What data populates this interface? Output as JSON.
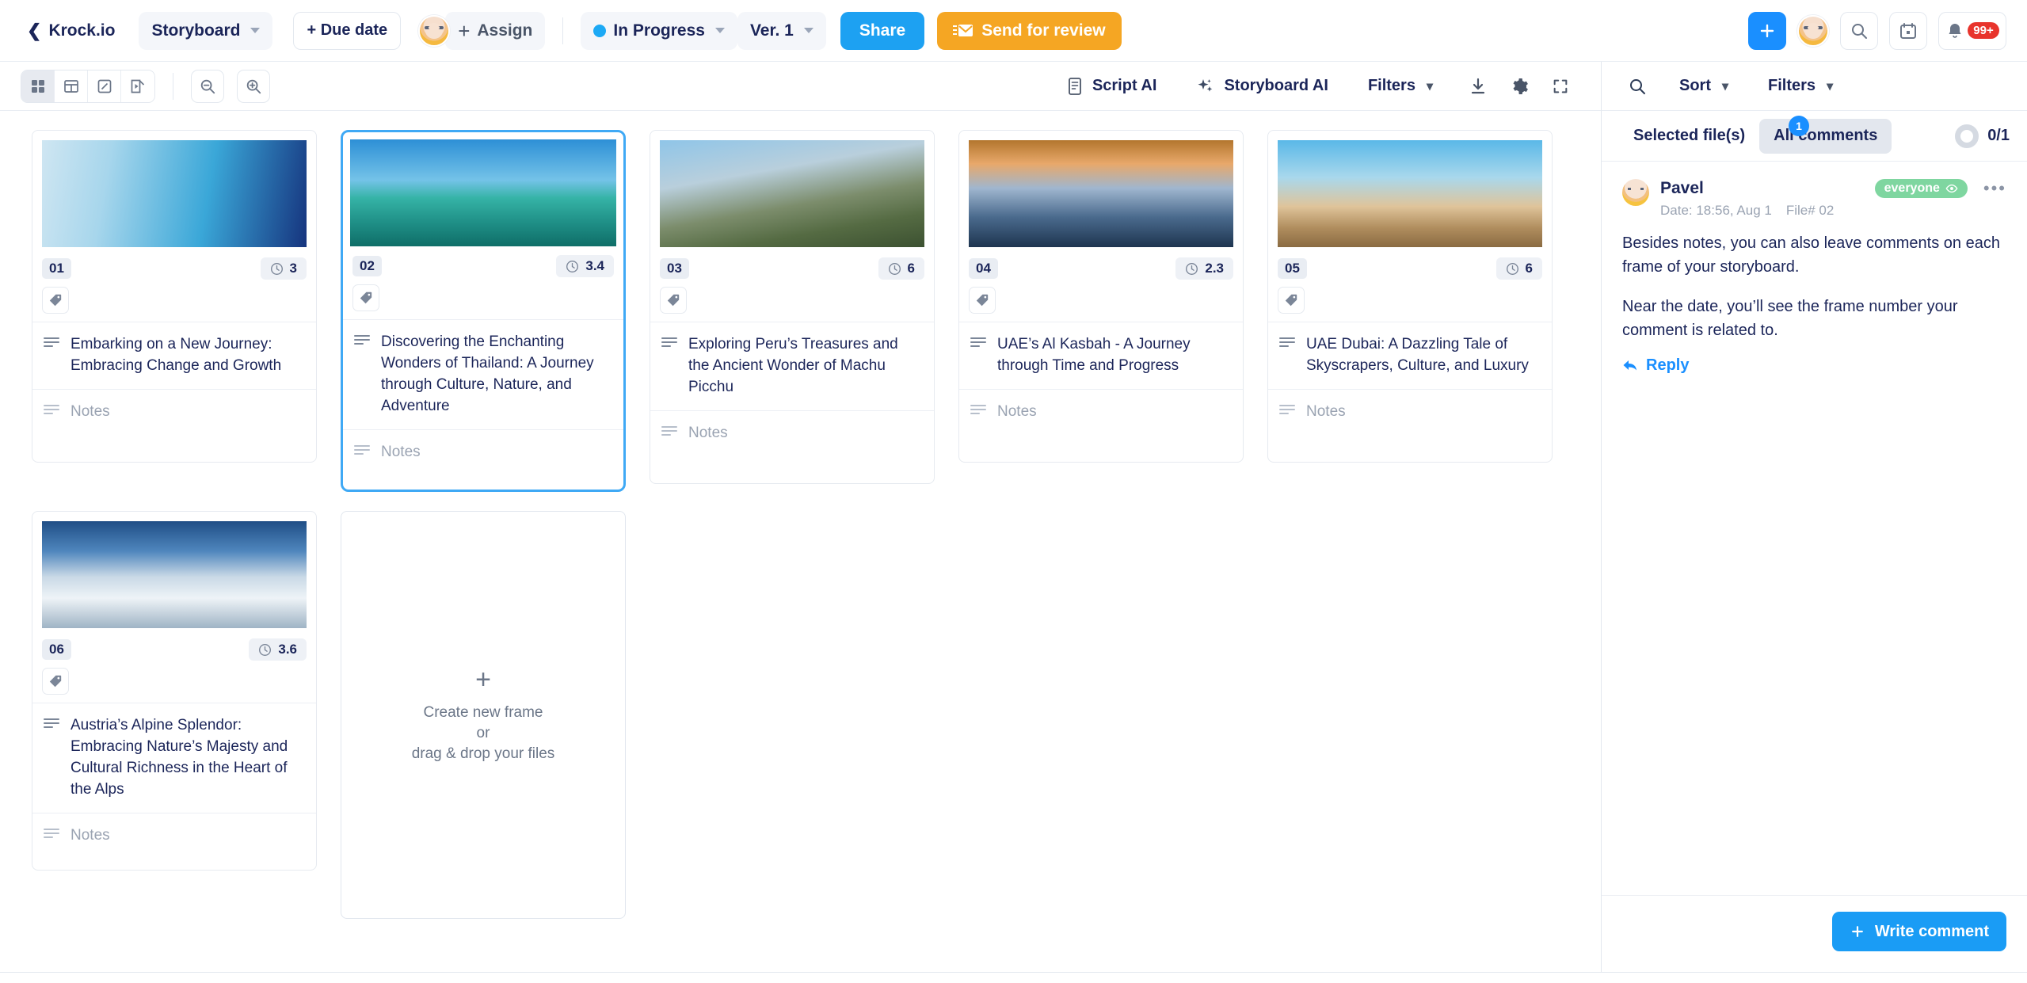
{
  "topbar": {
    "back_label": "Krock.io",
    "project_label": "Storyboard",
    "due_date_label": "+ Due date",
    "assign_label": "Assign",
    "status_label": "In Progress",
    "status_color": "#1ca9f5",
    "version_label": "Ver. 1",
    "share_label": "Share",
    "send_review_label": "Send for review",
    "notifications_badge": "99+",
    "icons": {
      "add": "plus-icon",
      "user": "avatar-icon",
      "search": "search-icon",
      "calendar": "calendar-icon",
      "bell": "bell-icon"
    }
  },
  "toolbar": {
    "view_modes": [
      "grid-view-icon",
      "table-view-icon",
      "edit-view-icon",
      "present-view-icon"
    ],
    "zoom_out": "zoom-out-icon",
    "zoom_in": "zoom-in-icon",
    "script_ai_label": "Script AI",
    "storyboard_ai_label": "Storyboard AI",
    "filters_label": "Filters",
    "download_icon": "download-icon",
    "settings_icon": "gear-icon",
    "fullscreen_icon": "fullscreen-icon"
  },
  "right_toolbar": {
    "search_icon": "search-icon",
    "sort_label": "Sort",
    "filters_label": "Filters"
  },
  "comments_panel": {
    "tab_selected_files": "Selected file(s)",
    "tab_all_comments": "All comments",
    "tab_badge": "1",
    "progress_label": "0/1",
    "comment": {
      "author": "Pavel",
      "date": "Date: 18:56, Aug 1",
      "file": "File# 02",
      "visibility": "everyone",
      "paragraph_1": "Besides notes, you can also leave comments on each frame of your storyboard.",
      "paragraph_2": "Near the date, you’ll see the frame number your comment is related to.",
      "reply_label": "Reply",
      "more_icon": "more-options-icon"
    },
    "write_comment_label": "Write comment"
  },
  "board": {
    "notes_placeholder": "Notes",
    "new_frame": {
      "line1": "Create new frame",
      "line2": "or",
      "line3": "drag & drop your files"
    },
    "cards": [
      {
        "number": "01",
        "duration": "3",
        "title": "Embarking on a New Journey: Embracing Change and Growth",
        "notes": "Notes",
        "selected": false
      },
      {
        "number": "02",
        "duration": "3.4",
        "title": "Discovering the Enchanting Wonders of Thailand: A Journey through Culture, Nature, and Adventure",
        "notes": "Notes",
        "selected": true
      },
      {
        "number": "03",
        "duration": "6",
        "title": "Exploring Peru’s Treasures and the Ancient Wonder of Machu Picchu",
        "notes": "Notes",
        "selected": false
      },
      {
        "number": "04",
        "duration": "2.3",
        "title": "UAE’s Al Kasbah - A Journey through Time and Progress",
        "notes": "Notes",
        "selected": false
      },
      {
        "number": "05",
        "duration": "6",
        "title": "UAE Dubai: A Dazzling Tale of Skyscrapers, Culture, and Luxury",
        "notes": "Notes",
        "selected": false
      },
      {
        "number": "06",
        "duration": "3.6",
        "title": "Austria’s Alpine Splendor: Embracing Nature’s Majesty and Cultural Richness in the Heart of the Alps",
        "notes": "Notes",
        "selected": false
      }
    ]
  },
  "colors": {
    "accent_blue": "#1a8fff",
    "orange": "#f5a623",
    "green": "#7fd6a0",
    "red": "#e8342c"
  }
}
